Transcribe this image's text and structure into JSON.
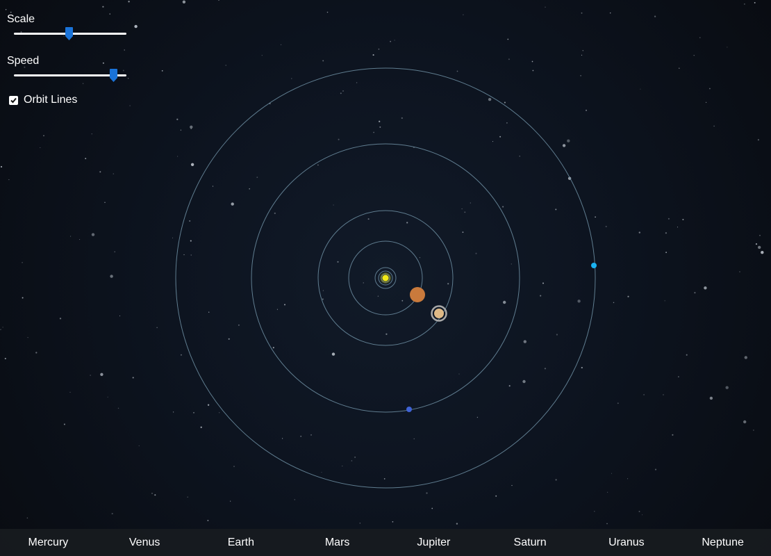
{
  "controls": {
    "scale": {
      "label": "Scale",
      "value": 0.49
    },
    "speed": {
      "label": "Speed",
      "value": 0.88
    },
    "orbit_lines": {
      "label": "Orbit Lines",
      "checked": true
    }
  },
  "planets": [
    "Mercury",
    "Venus",
    "Earth",
    "Mars",
    "Jupiter",
    "Saturn",
    "Uranus",
    "Neptune"
  ],
  "colors": {
    "sun": "#f2ea1a",
    "orbit": "#6e8fa3",
    "jupiter": "#c97a3c",
    "saturn": "#dfb986",
    "saturn_ring": "#a8a8a8",
    "uranus": "#1ab2f0",
    "neptune": "#3f63d6",
    "slider_thumb": "#1a73d9"
  }
}
